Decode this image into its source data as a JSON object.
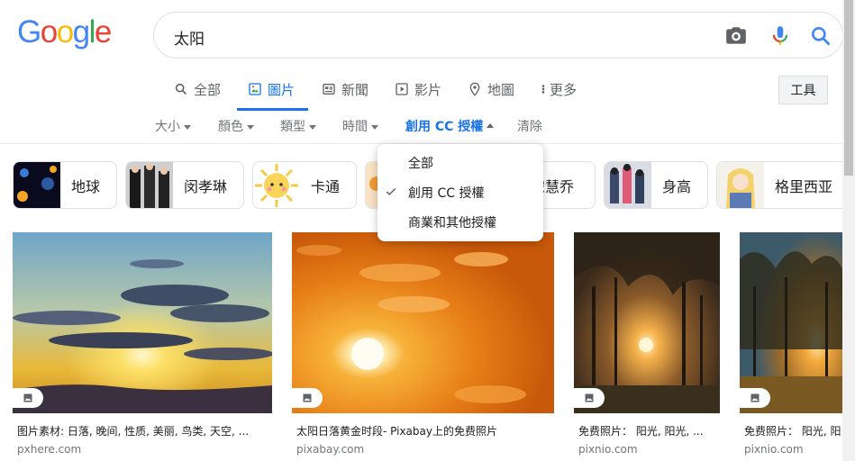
{
  "logo": {
    "letters": [
      "G",
      "o",
      "o",
      "g",
      "l",
      "e"
    ],
    "colors": [
      "#4285F4",
      "#EA4335",
      "#FBBC05",
      "#4285F4",
      "#34A853",
      "#EA4335"
    ]
  },
  "search": {
    "query": "太阳"
  },
  "tabs": [
    {
      "label": "全部",
      "icon": "search-icon"
    },
    {
      "label": "圖片",
      "icon": "image-icon",
      "active": true
    },
    {
      "label": "新聞",
      "icon": "news-icon"
    },
    {
      "label": "影片",
      "icon": "video-icon"
    },
    {
      "label": "地圖",
      "icon": "map-pin-icon"
    },
    {
      "label": "更多",
      "icon": "more-vert-icon"
    }
  ],
  "tools_label": "工具",
  "filters": [
    {
      "label": "大小"
    },
    {
      "label": "顏色"
    },
    {
      "label": "類型"
    },
    {
      "label": "時間"
    },
    {
      "label": "創用 CC 授權",
      "active": true
    },
    {
      "label": "清除"
    }
  ],
  "chips": [
    {
      "label": "地球"
    },
    {
      "label": "闵孝琳"
    },
    {
      "label": "卡通"
    },
    {
      "label": "宋慧乔"
    },
    {
      "label": "身高"
    },
    {
      "label": "格里西亚"
    }
  ],
  "license_menu": {
    "items": [
      {
        "label": "全部"
      },
      {
        "label": "創用 CC 授權",
        "checked": true
      },
      {
        "label": "商業和其他授權"
      }
    ]
  },
  "results": [
    {
      "title": "图片素材: 日落, 晚间, 性质, 美丽, 鸟类, 天空, ...",
      "source": "pxhere.com"
    },
    {
      "title": "太阳日落黄金时段- Pixabay上的免费照片",
      "source": "pixabay.com"
    },
    {
      "title": "免费照片： 阳光, 阳光, ...",
      "source": "pixnio.com"
    },
    {
      "title": "免费照片： 阳光, 阳",
      "source": "pixnio.com"
    }
  ],
  "colors": {
    "accent": "#1a73e8",
    "muted": "#70757a"
  }
}
